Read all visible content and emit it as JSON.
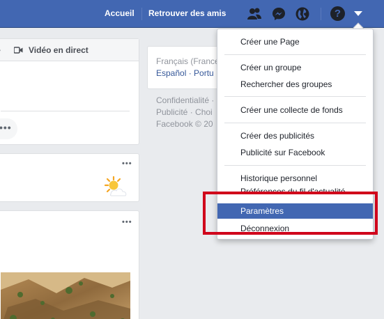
{
  "topbar": {
    "home": "Accueil",
    "find_friends": "Retrouver des amis",
    "icons": [
      "friend-requests-icon",
      "messenger-icon",
      "notifications-globe-icon"
    ],
    "help": "?"
  },
  "composer": {
    "live_video": "Vidéo en direct"
  },
  "right_column": {
    "language_current": "Français (France)",
    "language_links": "Español · Portu",
    "footer_line1": "Confidentialité ·",
    "footer_line2": "Publicité · Choi",
    "footer_line3": "Facebook © 20"
  },
  "menu": {
    "items": [
      {
        "label": "Créer une Page"
      },
      {
        "label": "Créer un groupe"
      },
      {
        "label": "Rechercher des groupes"
      },
      {
        "label": "Créer une collecte de fonds"
      },
      {
        "label": "Créer des publicités"
      },
      {
        "label": "Publicité sur Facebook"
      },
      {
        "label": "Historique personnel"
      },
      {
        "label": "Préférences du fil d'actualité"
      },
      {
        "label": "Paramètres"
      },
      {
        "label": "Déconnexion"
      }
    ],
    "active": "Paramètres"
  },
  "colors": {
    "brand_blue": "#4267b2",
    "highlight_red": "#d0021b"
  }
}
